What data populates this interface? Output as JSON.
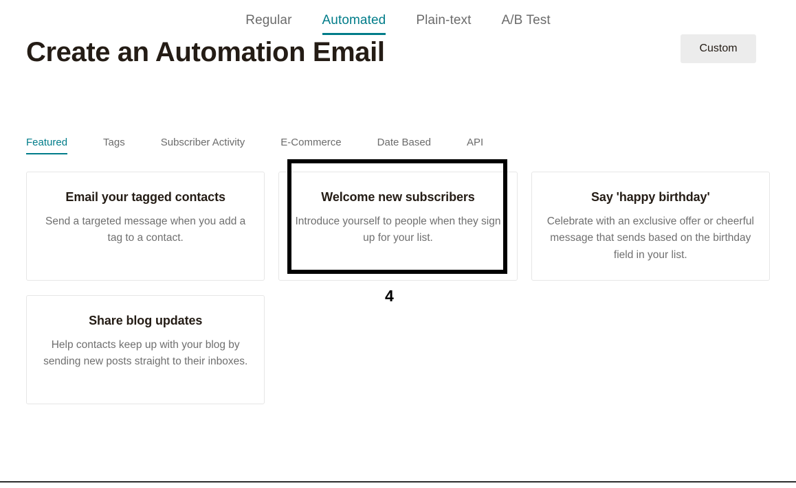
{
  "type_tabs": [
    {
      "label": "Regular",
      "active": false
    },
    {
      "label": "Automated",
      "active": true
    },
    {
      "label": "Plain-text",
      "active": false
    },
    {
      "label": "A/B Test",
      "active": false
    }
  ],
  "header": {
    "title": "Create an Automation Email",
    "custom_button": "Custom"
  },
  "category_tabs": [
    {
      "label": "Featured",
      "active": true
    },
    {
      "label": "Tags",
      "active": false
    },
    {
      "label": "Subscriber Activity",
      "active": false
    },
    {
      "label": "E-Commerce",
      "active": false
    },
    {
      "label": "Date Based",
      "active": false
    },
    {
      "label": "API",
      "active": false
    }
  ],
  "cards": [
    {
      "title": "Email your tagged contacts",
      "desc": "Send a targeted message when you add a tag to a contact."
    },
    {
      "title": "Welcome new subscribers",
      "desc": "Introduce yourself to people when they sign up for your list."
    },
    {
      "title": "Say 'happy birthday'",
      "desc": "Celebrate with an exclusive offer or cheerful message that sends based on the birthday field in your list."
    },
    {
      "title": "Share blog updates",
      "desc": "Help contacts keep up with your blog by sending new posts straight to their inboxes."
    }
  ],
  "annotation": {
    "number": "4"
  },
  "colors": {
    "accent": "#007c89",
    "text": "#241c15",
    "muted": "#6f6f6f",
    "card_border": "#e6e6e6",
    "button_bg": "#ececec",
    "annotation": "#000000"
  }
}
